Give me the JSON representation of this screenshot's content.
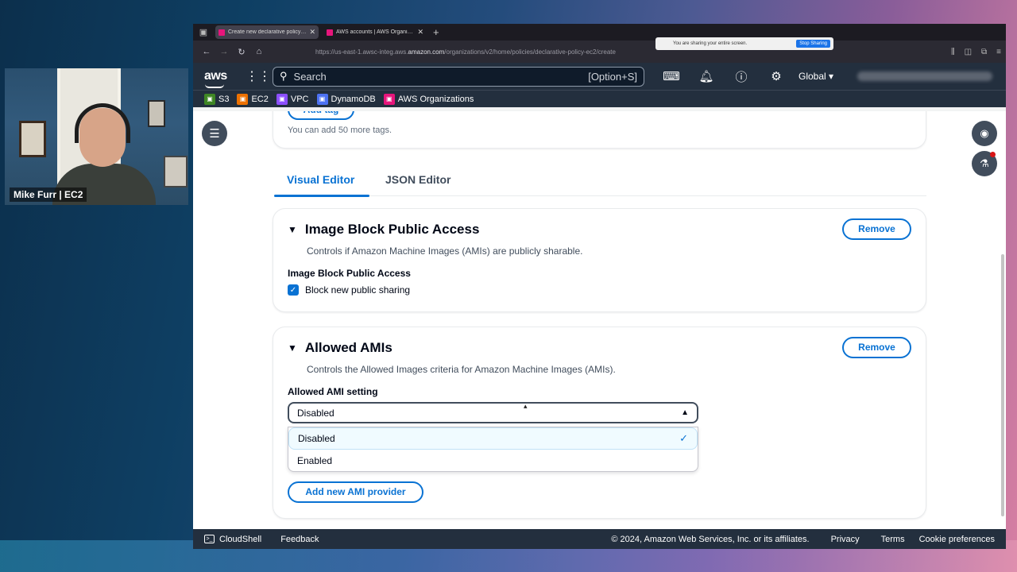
{
  "webcam": {
    "name": "Mike Furr | EC2"
  },
  "browser": {
    "tabs": [
      {
        "title": "Create new declarative policy f...",
        "active": true
      },
      {
        "title": "AWS accounts | AWS Organizati...",
        "active": false
      }
    ],
    "url_prefix": "https://us-east-1.awsc-integ.aws.",
    "url_domain": "amazon.com",
    "url_path": "/organizations/v2/home/policies/declarative-policy-ec2/create",
    "share_notice": "You are sharing your entire screen.",
    "stop_sharing": "Stop Sharing"
  },
  "aws_nav": {
    "logo": "aws",
    "search_placeholder": "Search",
    "search_shortcut": "[Option+S]",
    "region": "Global"
  },
  "favorites": [
    {
      "label": "S3",
      "color": "#3f8624"
    },
    {
      "label": "EC2",
      "color": "#ed7100"
    },
    {
      "label": "VPC",
      "color": "#8c4fff"
    },
    {
      "label": "DynamoDB",
      "color": "#4d72f3"
    },
    {
      "label": "AWS Organizations",
      "color": "#e7157b"
    }
  ],
  "tags": {
    "add_label": "Add tag",
    "hint": "You can add 50 more tags."
  },
  "editor_tabs": {
    "visual": "Visual Editor",
    "json": "JSON Editor"
  },
  "image_block": {
    "title": "Image Block Public Access",
    "description": "Controls if Amazon Machine Images (AMIs) are publicly sharable.",
    "remove": "Remove",
    "field_label": "Image Block Public Access",
    "checkbox_label": "Block new public sharing",
    "checked": true
  },
  "allowed_amis": {
    "title": "Allowed AMIs",
    "description": "Controls the Allowed Images criteria for Amazon Machine Images (AMIs).",
    "remove": "Remove",
    "field_label": "Allowed AMI setting",
    "selected": "Disabled",
    "options": [
      "Disabled",
      "Enabled"
    ],
    "add_provider": "Add new AMI provider"
  },
  "footer": {
    "cloudshell": "CloudShell",
    "feedback": "Feedback",
    "copyright": "© 2024, Amazon Web Services, Inc. or its affiliates.",
    "links": [
      "Privacy",
      "Terms",
      "Cookie preferences"
    ]
  },
  "colors": {
    "accent": "#0972d3",
    "nav_bg": "#232f3e"
  }
}
